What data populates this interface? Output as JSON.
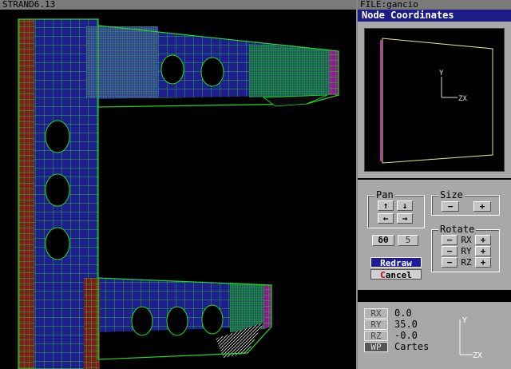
{
  "app": {
    "title": "STRAND6.13"
  },
  "file": {
    "label": "FILE:gancio"
  },
  "panel": {
    "title": "Node Coordinates"
  },
  "preview": {
    "axis_y": "Y",
    "axis_zx": "ZX"
  },
  "controls": {
    "pan": {
      "title": "Pan",
      "up": "↑",
      "down": "↓",
      "left": "←",
      "right": "→"
    },
    "size": {
      "title": "Size",
      "minus": "−",
      "plus": "+"
    },
    "delta_theta": {
      "label": "δθ",
      "value": "5"
    },
    "rotate": {
      "title": "Rotate",
      "rows": [
        {
          "minus": "−",
          "axis": "RX",
          "plus": "+"
        },
        {
          "minus": "−",
          "axis": "RY",
          "plus": "+"
        },
        {
          "minus": "−",
          "axis": "RZ",
          "plus": "+"
        }
      ]
    },
    "redraw_label": "Redraw",
    "cancel_hot": "C",
    "cancel_rest": "ancel"
  },
  "status": {
    "rows": [
      {
        "key": "RX",
        "value": "0.0"
      },
      {
        "key": "RY",
        "value": "35.0"
      },
      {
        "key": "RZ",
        "value": "-0.0"
      },
      {
        "key": "WP",
        "value": "Cartes"
      }
    ],
    "axis_y": "Y",
    "axis_zx": "ZX"
  },
  "colors": {
    "mesh_line": "#22dd22",
    "fill_blue": "#1e1e8c",
    "fill_red": "#7a1e1e",
    "fill_magenta": "#8a1e8a",
    "preview_yellow": "#e8e880",
    "preview_magenta": "#ff40ff"
  }
}
